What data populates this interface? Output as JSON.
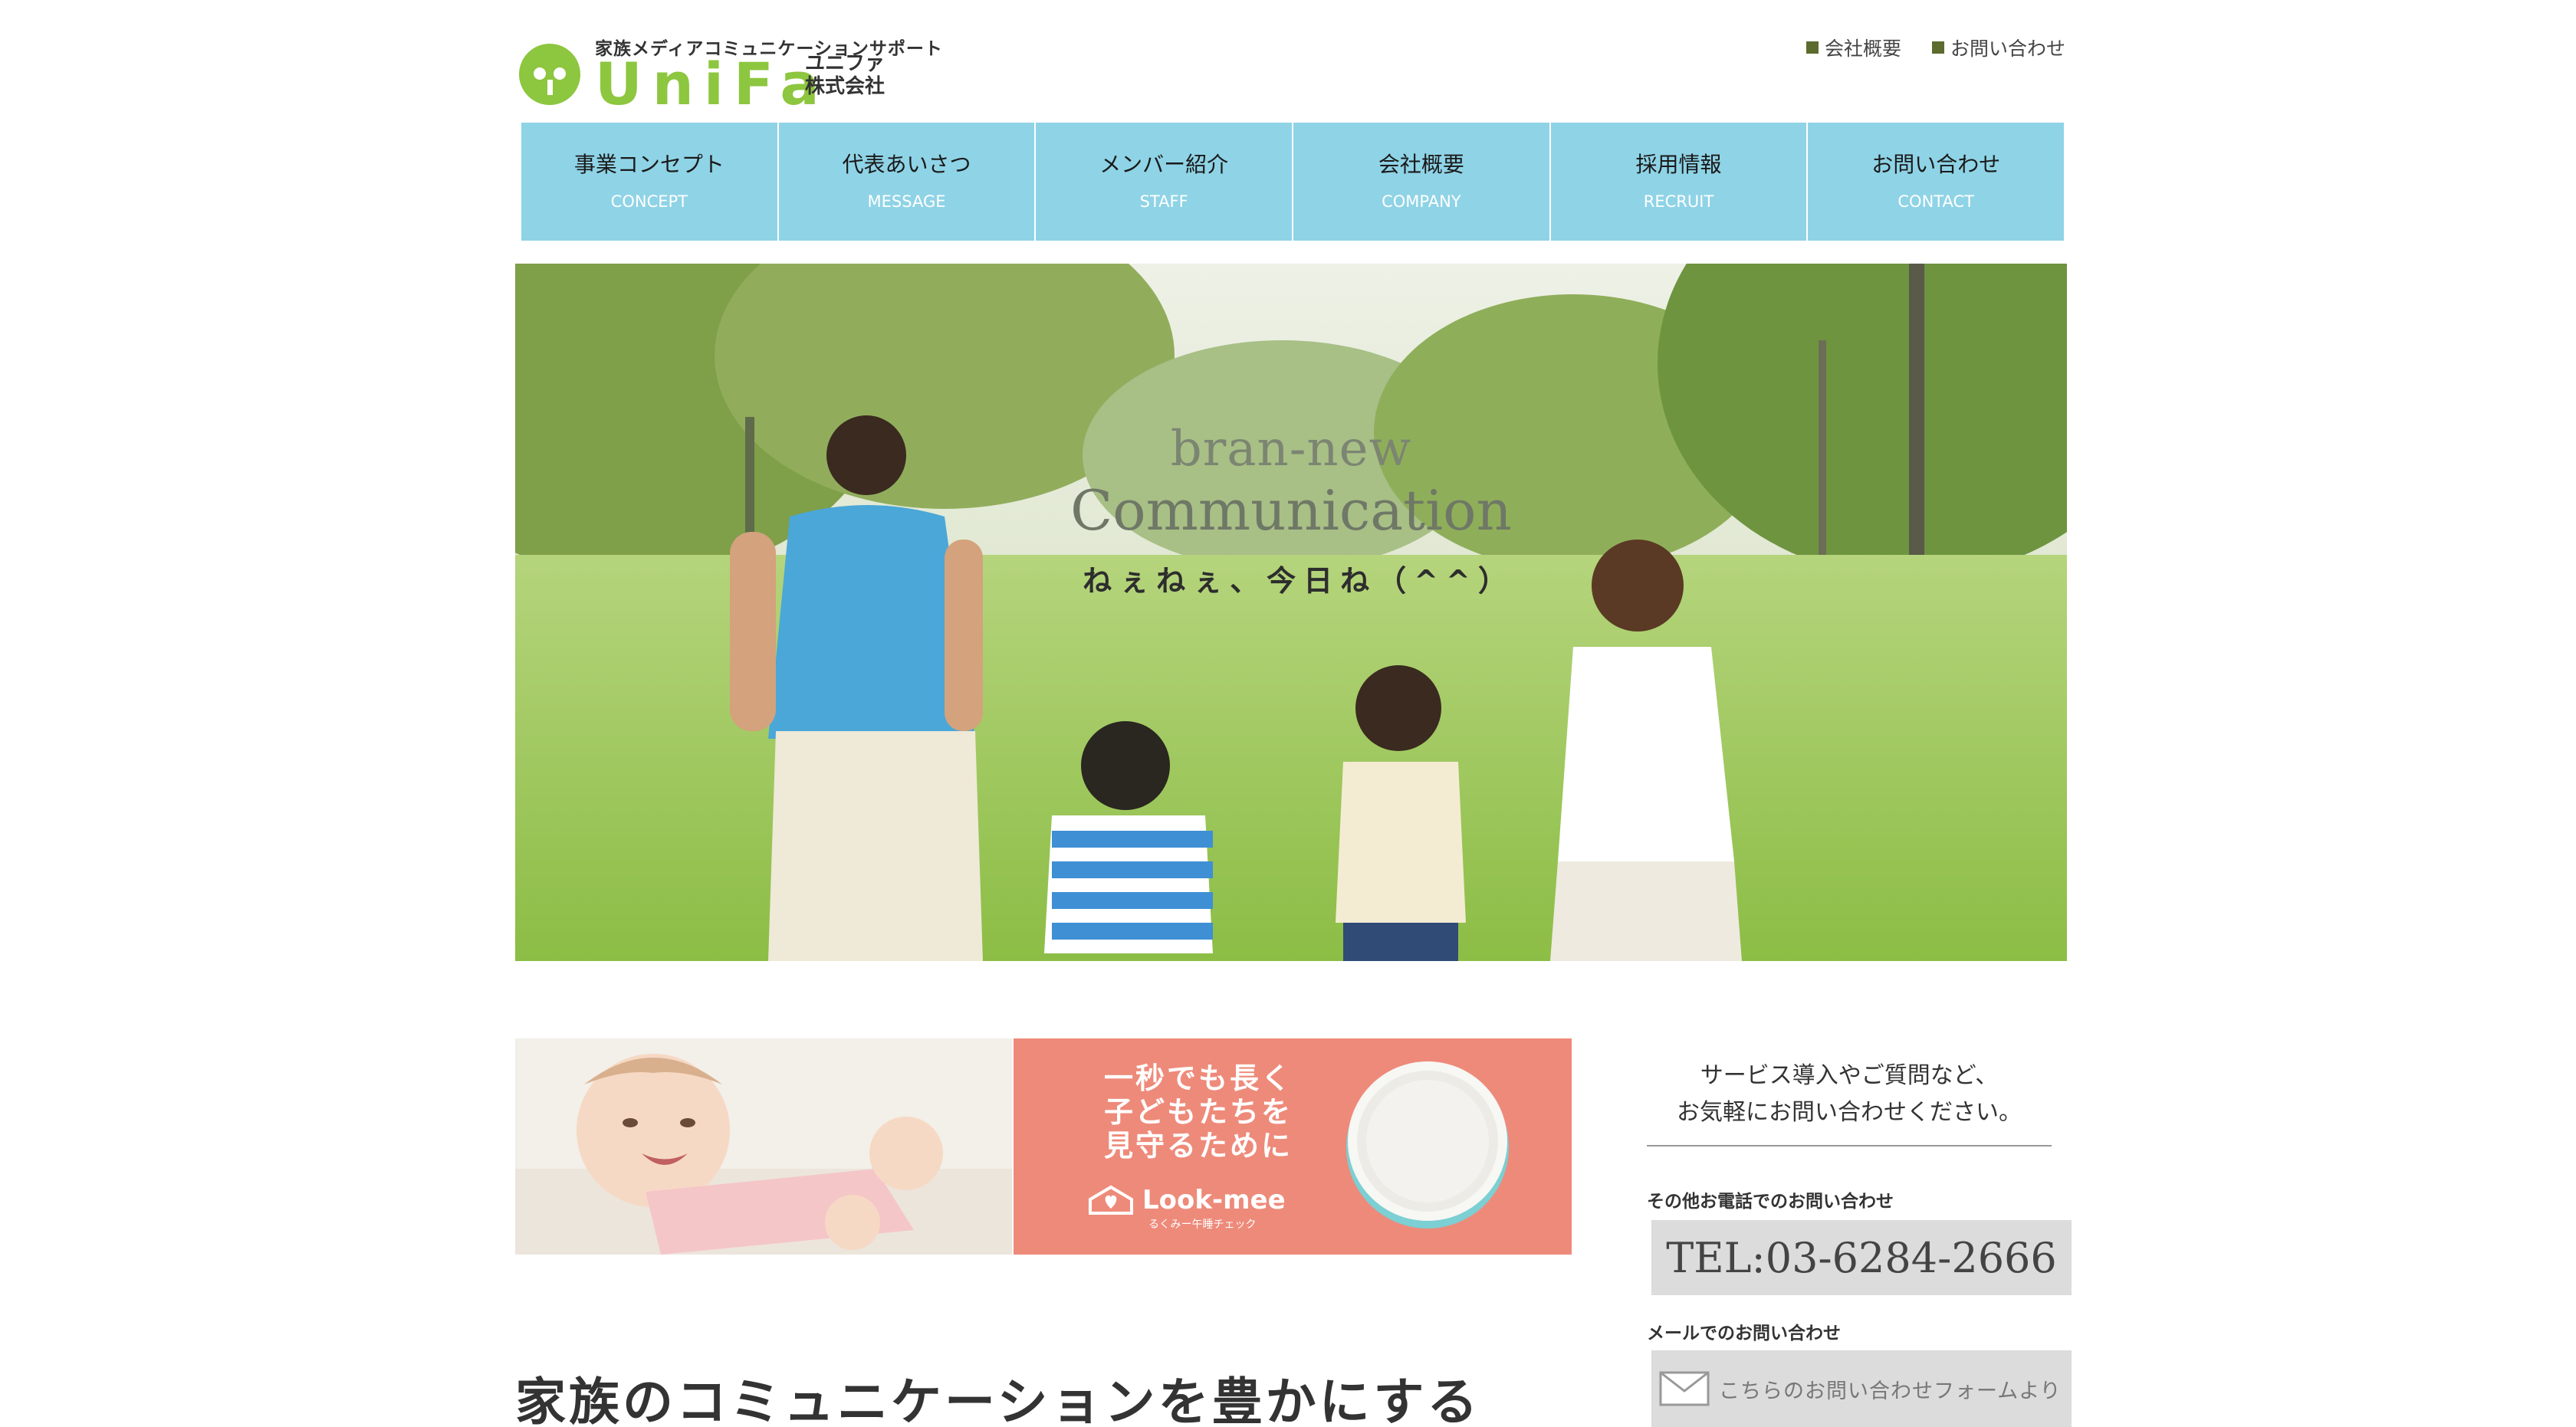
{
  "header": {
    "tagline": "家族メディアコミュニケーションサポート",
    "logo_word": "UniFa",
    "logo_kana_line1": "ユニファ",
    "logo_kana_line2": "株式会社",
    "top_links": [
      "会社概要",
      "お問い合わせ"
    ]
  },
  "nav": [
    {
      "jp": "事業コンセプト",
      "en": "CONCEPT"
    },
    {
      "jp": "代表あいさつ",
      "en": "MESSAGE"
    },
    {
      "jp": "メンバー紹介",
      "en": "STAFF"
    },
    {
      "jp": "会社概要",
      "en": "COMPANY"
    },
    {
      "jp": "採用情報",
      "en": "RECRUIT"
    },
    {
      "jp": "お問い合わせ",
      "en": "CONTACT"
    }
  ],
  "hero": {
    "line1": "bran-new",
    "line2": "Communication",
    "line3": "ねぇねぇ、今日ね（^^）"
  },
  "banner": {
    "copy_line1": "一秒でも長く",
    "copy_line2": "子どもたちを",
    "copy_line3": "見守るために",
    "brand": "Look-mee",
    "brand_sub": "るくみー午睡チェック"
  },
  "main": {
    "heading": "家族のコミュニケーションを豊かにする"
  },
  "sidebar": {
    "lead_line1": "サービス導入やご質問など、",
    "lead_line2": "お気軽にお問い合わせください。",
    "tel_label": "その他お電話でのお問い合わせ",
    "tel": "TEL:03-6284-2666",
    "mail_label": "メールでのお問い合わせ",
    "mail_button": "こちらのお問い合わせフォームより"
  },
  "colors": {
    "nav_bg": "#8fd3e6",
    "logo_green": "#8dc63f",
    "banner_pink": "#ee8a7a",
    "contact_box": "#dcdcdc",
    "link_marker": "#5c6b2e"
  },
  "icons": {
    "logo_badge": "child-face-badge-icon",
    "link_marker": "square-bullet-icon",
    "brand_mark": "house-heart-icon",
    "mail": "envelope-icon"
  }
}
